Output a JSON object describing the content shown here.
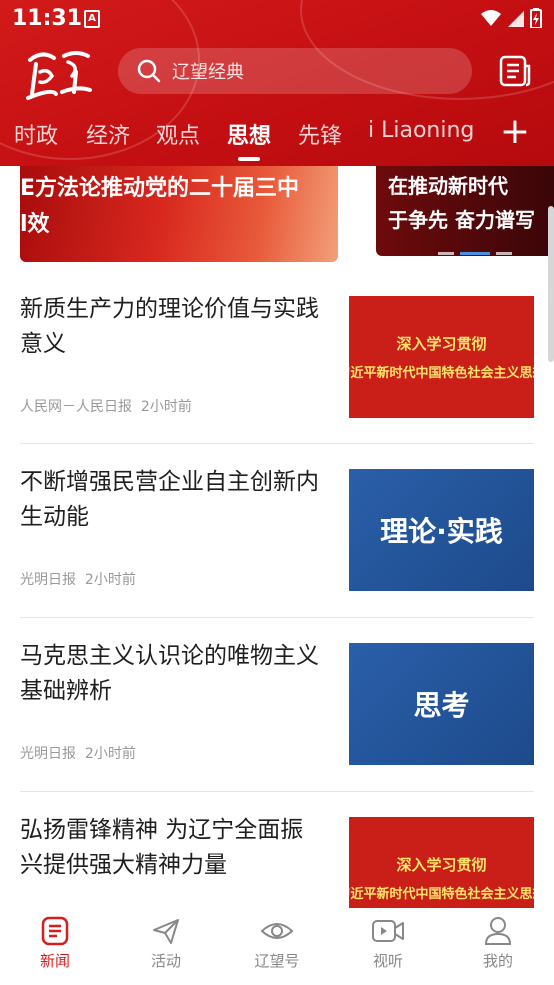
{
  "status_bar": {
    "time": "11:31",
    "notification_icon": "A"
  },
  "header": {
    "logo_icon": "liaowang-logo",
    "search_placeholder": "辽望经典",
    "tabs": [
      {
        "label": "时政"
      },
      {
        "label": "经济"
      },
      {
        "label": "观点"
      },
      {
        "label": "思想",
        "active": true
      },
      {
        "label": "先锋"
      },
      {
        "label": "i Liaoning"
      }
    ],
    "add_label": "+"
  },
  "carousel": {
    "slide1": {
      "line1": "E方法论推动党的二十届三中",
      "line2": "l效"
    },
    "slide2": {
      "line1": "在推动新时代",
      "line2": "于争先 奋力谱写"
    }
  },
  "news": [
    {
      "title": "新质生产力的理论价值与实践意义",
      "source": "人民网－人民日报",
      "time": "2小时前",
      "thumb": {
        "style": "red",
        "line1": "深入学习贯彻",
        "line2": "习近平新时代中国特色社会主义思想"
      }
    },
    {
      "title": "不断增强民营企业自主创新内生动能",
      "source": "光明日报",
      "time": "2小时前",
      "thumb": {
        "style": "blue",
        "text": "理论·实践"
      }
    },
    {
      "title": "马克思主义认识论的唯物主义基础辨析",
      "source": "光明日报",
      "time": "2小时前",
      "thumb": {
        "style": "blue",
        "text": "思考"
      }
    },
    {
      "title": "弘扬雷锋精神 为辽宁全面振兴提供强大精神力量",
      "thumb": {
        "style": "red",
        "line1": "深入学习贯彻",
        "line2": "习近平新时代中国特色社会主义思想"
      }
    }
  ],
  "bottom_nav": [
    {
      "label": "新闻",
      "icon": "news-icon",
      "active": true
    },
    {
      "label": "活动",
      "icon": "paper-plane-icon"
    },
    {
      "label": "辽望号",
      "icon": "eye-icon"
    },
    {
      "label": "视听",
      "icon": "video-icon"
    },
    {
      "label": "我的",
      "icon": "person-icon"
    }
  ],
  "colors": {
    "brand_red": "#c8141a",
    "active_nav": "#d51e1e",
    "thumb_blue": "#1d4a8b",
    "thumb_gold": "#ffe46b"
  }
}
